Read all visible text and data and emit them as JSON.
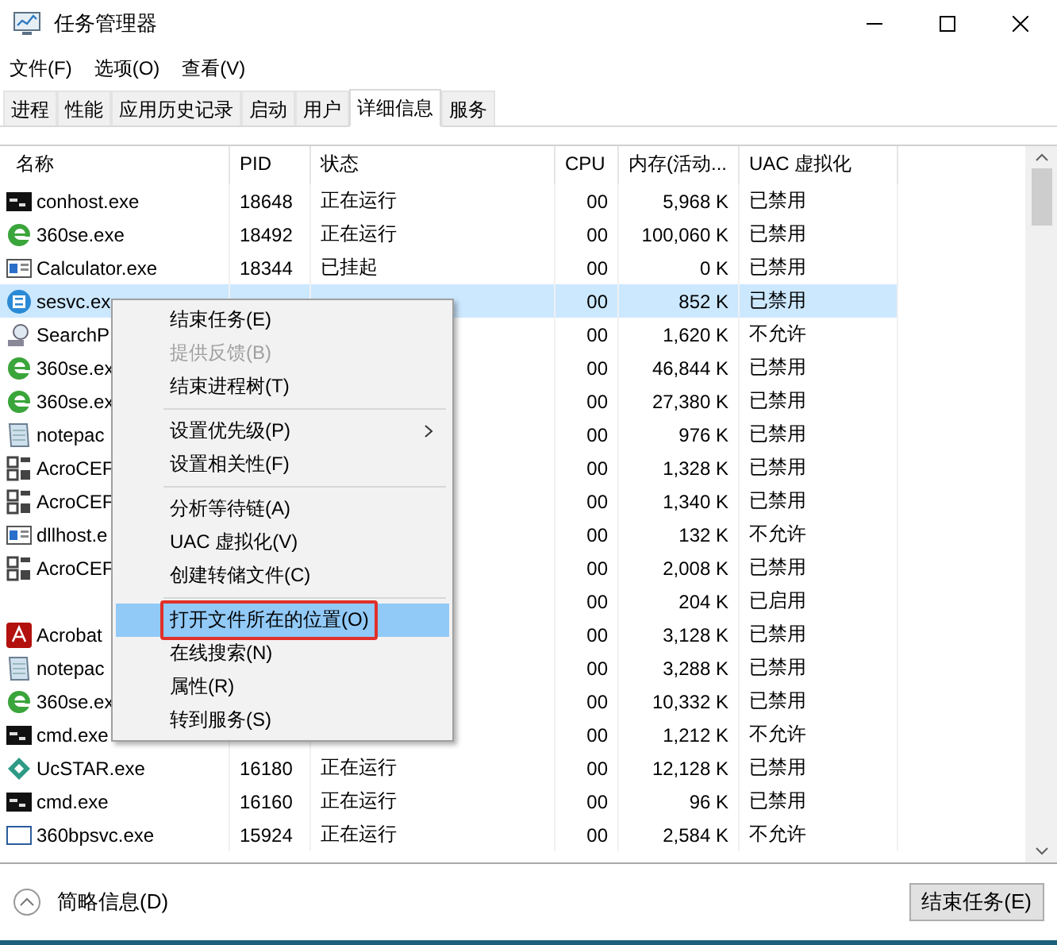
{
  "window": {
    "title": "任务管理器"
  },
  "menubar": [
    "文件(F)",
    "选项(O)",
    "查看(V)"
  ],
  "tabs": [
    {
      "label": "进程",
      "selected": false
    },
    {
      "label": "性能",
      "selected": false
    },
    {
      "label": "应用历史记录",
      "selected": false
    },
    {
      "label": "启动",
      "selected": false
    },
    {
      "label": "用户",
      "selected": false
    },
    {
      "label": "详细信息",
      "selected": true
    },
    {
      "label": "服务",
      "selected": false
    }
  ],
  "table": {
    "columns": [
      "名称",
      "PID",
      "状态",
      "CPU",
      "内存(活动...",
      "UAC 虚拟化"
    ],
    "rows": [
      {
        "kind": "console",
        "name": "conhost.exe",
        "pid": "18648",
        "status": "正在运行",
        "cpu": "00",
        "memory": "5,968 K",
        "uac": "已禁用",
        "selected": false
      },
      {
        "kind": "browser",
        "name": "360se.exe",
        "pid": "18492",
        "status": "正在运行",
        "cpu": "00",
        "memory": "100,060 K",
        "uac": "已禁用",
        "selected": false
      },
      {
        "kind": "app",
        "name": "Calculator.exe",
        "pid": "18344",
        "status": "已挂起",
        "cpu": "00",
        "memory": "0 K",
        "uac": "已禁用",
        "selected": false
      },
      {
        "kind": "service",
        "name": "sesvc.ex",
        "cpu": "00",
        "memory": "852 K",
        "uac": "已禁用",
        "selected": true
      },
      {
        "kind": "search",
        "name": "SearchP",
        "cpu": "00",
        "memory": "1,620 K",
        "uac": "不允许",
        "selected": false
      },
      {
        "kind": "browser",
        "name": "360se.ex",
        "cpu": "00",
        "memory": "46,844 K",
        "uac": "已禁用",
        "selected": false
      },
      {
        "kind": "browser",
        "name": "360se.ex",
        "cpu": "00",
        "memory": "27,380 K",
        "uac": "已禁用",
        "selected": false
      },
      {
        "kind": "notepad",
        "name": "notepac",
        "cpu": "00",
        "memory": "976 K",
        "uac": "已禁用",
        "selected": false
      },
      {
        "kind": "grid",
        "name": "AcroCEF",
        "cpu": "00",
        "memory": "1,328 K",
        "uac": "已禁用",
        "selected": false
      },
      {
        "kind": "grid",
        "name": "AcroCEF",
        "cpu": "00",
        "memory": "1,340 K",
        "uac": "已禁用",
        "selected": false
      },
      {
        "kind": "app",
        "name": "dllhost.e",
        "cpu": "00",
        "memory": "132 K",
        "uac": "不允许",
        "selected": false
      },
      {
        "kind": "grid",
        "name": "AcroCEF",
        "cpu": "00",
        "memory": "2,008 K",
        "uac": "已禁用",
        "selected": false
      },
      {
        "kind": "blank",
        "cpu": "00",
        "memory": "204 K",
        "uac": "已启用",
        "selected": false
      },
      {
        "kind": "pdf",
        "name": "Acrobat",
        "cpu": "00",
        "memory": "3,128 K",
        "uac": "已禁用",
        "selected": false
      },
      {
        "kind": "notepad",
        "name": "notepac",
        "cpu": "00",
        "memory": "3,288 K",
        "uac": "已禁用",
        "selected": false
      },
      {
        "kind": "browser",
        "name": "360se.ex",
        "cpu": "00",
        "memory": "10,332 K",
        "uac": "已禁用",
        "selected": false
      },
      {
        "kind": "console",
        "name": "cmd.exe",
        "cpu": "00",
        "memory": "1,212 K",
        "uac": "不允许",
        "selected": false
      },
      {
        "kind": "diamond",
        "name": "UcSTAR.exe",
        "pid": "16180",
        "status": "正在运行",
        "cpu": "00",
        "memory": "12,128 K",
        "uac": "已禁用",
        "selected": false
      },
      {
        "kind": "console",
        "name": "cmd.exe",
        "pid": "16160",
        "status": "正在运行",
        "cpu": "00",
        "memory": "96 K",
        "uac": "已禁用",
        "selected": false
      },
      {
        "kind": "frame",
        "name": "360bpsvc.exe",
        "pid": "15924",
        "status": "正在运行",
        "cpu": "00",
        "memory": "2,584 K",
        "uac": "不允许",
        "selected": false
      }
    ]
  },
  "context_menu": [
    {
      "kind": "item",
      "label": "结束任务(E)",
      "disabled": false,
      "selected": false
    },
    {
      "kind": "item",
      "label": "提供反馈(B)",
      "disabled": true,
      "selected": false
    },
    {
      "kind": "item",
      "label": "结束进程树(T)",
      "disabled": false,
      "selected": false
    },
    {
      "kind": "separator"
    },
    {
      "kind": "item",
      "label": "设置优先级(P)",
      "disabled": false,
      "selected": false,
      "submenu": true
    },
    {
      "kind": "item",
      "label": "设置相关性(F)",
      "disabled": false,
      "selected": false
    },
    {
      "kind": "separator"
    },
    {
      "kind": "item",
      "label": "分析等待链(A)",
      "disabled": false,
      "selected": false
    },
    {
      "kind": "item",
      "label": "UAC 虚拟化(V)",
      "disabled": false,
      "selected": false
    },
    {
      "kind": "item",
      "label": "创建转储文件(C)",
      "disabled": false,
      "selected": false
    },
    {
      "kind": "separator"
    },
    {
      "kind": "item",
      "label": "打开文件所在的位置(O)",
      "disabled": false,
      "selected": true
    },
    {
      "kind": "item",
      "label": "在线搜索(N)",
      "disabled": false,
      "selected": false
    },
    {
      "kind": "item",
      "label": "属性(R)",
      "disabled": false,
      "selected": false
    },
    {
      "kind": "item",
      "label": "转到服务(S)",
      "disabled": false,
      "selected": false
    }
  ],
  "footer": {
    "details_toggle": "简略信息(D)",
    "end_task_button": "结束任务(E)"
  }
}
